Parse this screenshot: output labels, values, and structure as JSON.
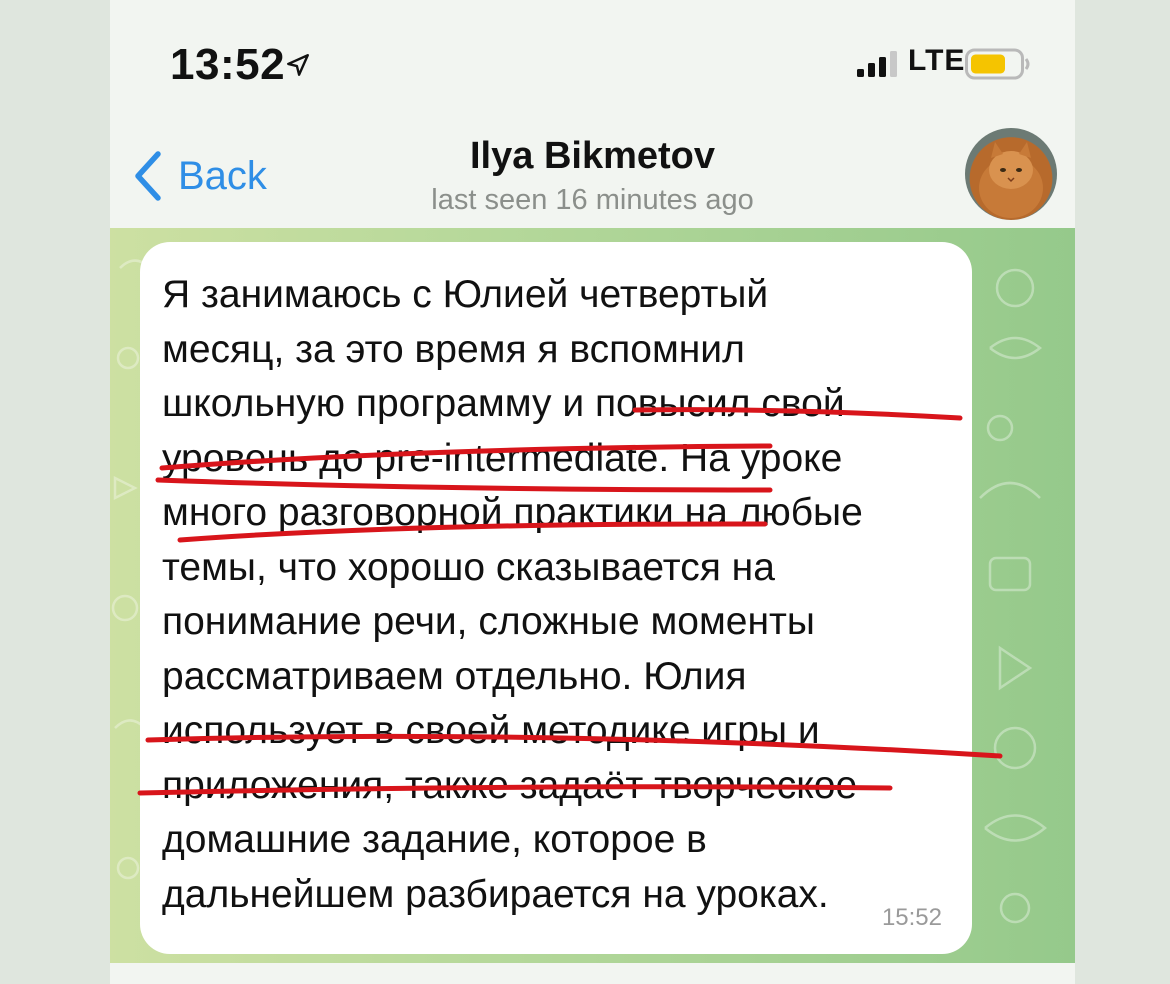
{
  "status_bar": {
    "time": "13:52",
    "network": "LTE",
    "location_icon": "location-arrow-icon",
    "signal_icon": "signal-bars-icon",
    "battery_icon": "battery-icon",
    "battery_color": "#f5c400"
  },
  "header": {
    "back_label": "Back",
    "title": "Ilya Bikmetov",
    "subtitle": "last seen 16 minutes ago"
  },
  "message": {
    "text": "Я занимаюсь с Юлией четвертый\nмесяц, за это время я вспомнил\nшкольную программу и повысил свой\nуровень до pre-intermediate. На уроке\nмного разговорной практики на любые\nтемы, что хорошо сказывается на\nпонимание речи, сложные моменты\nрассматриваем отдельно. Юлия\nиспользует в своей методике игры и\nприложения, также задаёт творческое\nдомашние задание, которое в\nдальнейшем разбирается на уроках.",
    "time": "15:52"
  },
  "colors": {
    "accent": "#2f8ee6",
    "annotation_red": "#d8151b",
    "chat_bg": "#b5d89a"
  }
}
